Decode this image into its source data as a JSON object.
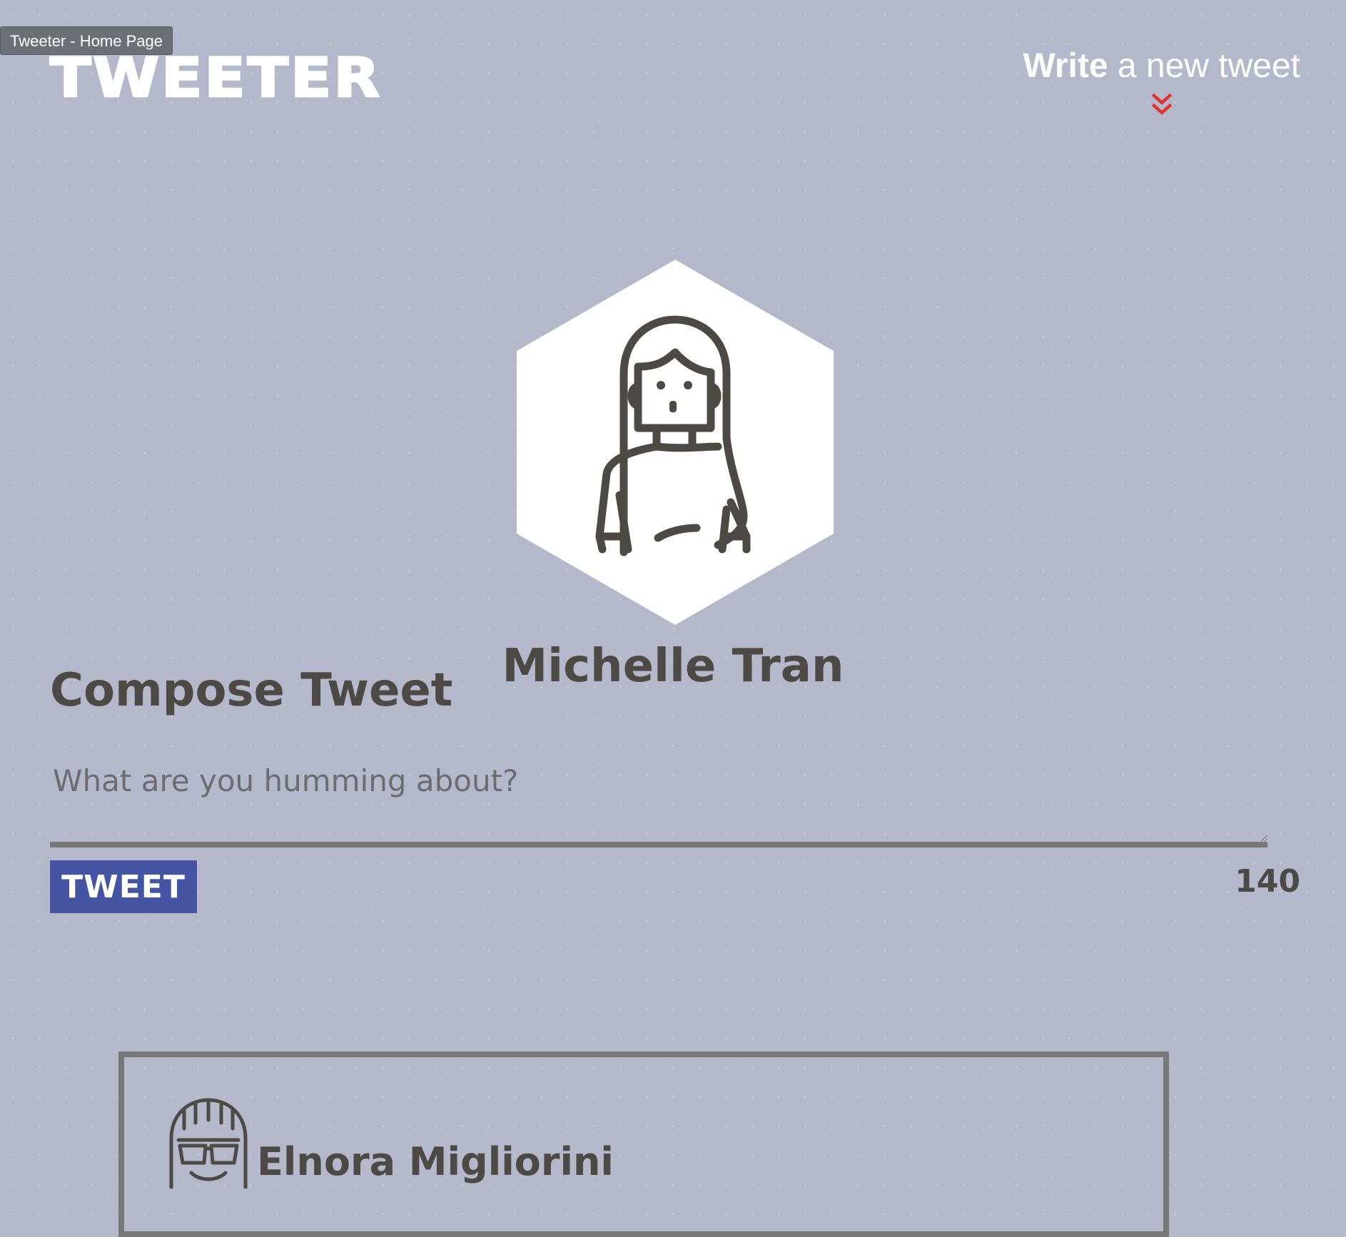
{
  "window": {
    "title": "Tweeter - Home Page"
  },
  "header": {
    "brand": "TWEETER",
    "nav_write_strong": "Write",
    "nav_write_rest": " a new tweet",
    "chevron_color": "#e0332b"
  },
  "profile": {
    "avatar_icon": "female-user-avatar-icon",
    "name": "Michelle Tran"
  },
  "compose": {
    "title": "Compose Tweet",
    "placeholder": "What are you humming about?",
    "value": "",
    "button_label": "TWEET",
    "counter": "140"
  },
  "tweets": [
    {
      "author": "Elnora Migliorini",
      "avatar_icon": "sunglasses-user-avatar-icon"
    }
  ],
  "colors": {
    "background": "#b4b8ca",
    "text": "#4d4a45",
    "button": "#4454a3",
    "accent": "#e0332b",
    "border": "#777777"
  }
}
